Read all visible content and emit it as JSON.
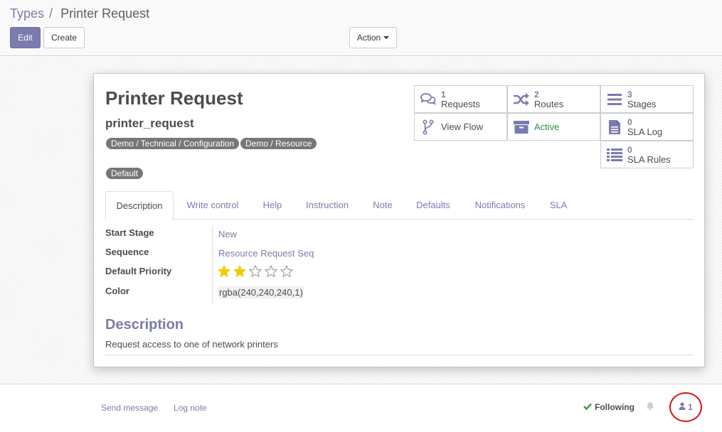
{
  "breadcrumb": {
    "parent": "Types",
    "separator": "/",
    "current": "Printer Request"
  },
  "toolbar": {
    "edit_label": "Edit",
    "create_label": "Create",
    "action_label": "Action"
  },
  "record": {
    "title": "Printer Request",
    "code": "printer_request",
    "tags": [
      "Demo / Technical / Configuration",
      "Demo / Resource",
      "Default"
    ]
  },
  "smart_buttons": {
    "requests": {
      "count": "1",
      "label": "Requests",
      "icon": "comments-icon"
    },
    "routes": {
      "count": "2",
      "label": "Routes",
      "icon": "random-icon"
    },
    "stages": {
      "count": "3",
      "label": "Stages",
      "icon": "bars-icon"
    },
    "view_flow": {
      "label": "View Flow",
      "icon": "code-fork-icon"
    },
    "active": {
      "label": "Active",
      "icon": "archive-icon"
    },
    "sla_log": {
      "count": "0",
      "label": "SLA Log",
      "icon": "file-text-icon"
    },
    "sla_rules": {
      "count": "0",
      "label": "SLA Rules",
      "icon": "list-icon"
    }
  },
  "tabs": [
    "Description",
    "Write control",
    "Help",
    "Instruction",
    "Note",
    "Defaults",
    "Notifications",
    "SLA"
  ],
  "active_tab": "Description",
  "fields": {
    "start_stage": {
      "label": "Start Stage",
      "value": "New"
    },
    "sequence": {
      "label": "Sequence",
      "value": "Resource Request Seq"
    },
    "default_priority": {
      "label": "Default Priority",
      "rating": 2,
      "max": 5
    },
    "color": {
      "label": "Color",
      "value": "rgba(240,240,240,1)"
    }
  },
  "description": {
    "heading": "Description",
    "text": "Request access to one of network printers"
  },
  "chatter": {
    "send_message": "Send message",
    "log_note": "Log note",
    "following": "Following",
    "followers_count": "1"
  },
  "colors": {
    "accent": "#7c7bad",
    "active_green": "#2f8a3f",
    "star": "#f3cc00",
    "highlight_circle": "#e01515"
  }
}
